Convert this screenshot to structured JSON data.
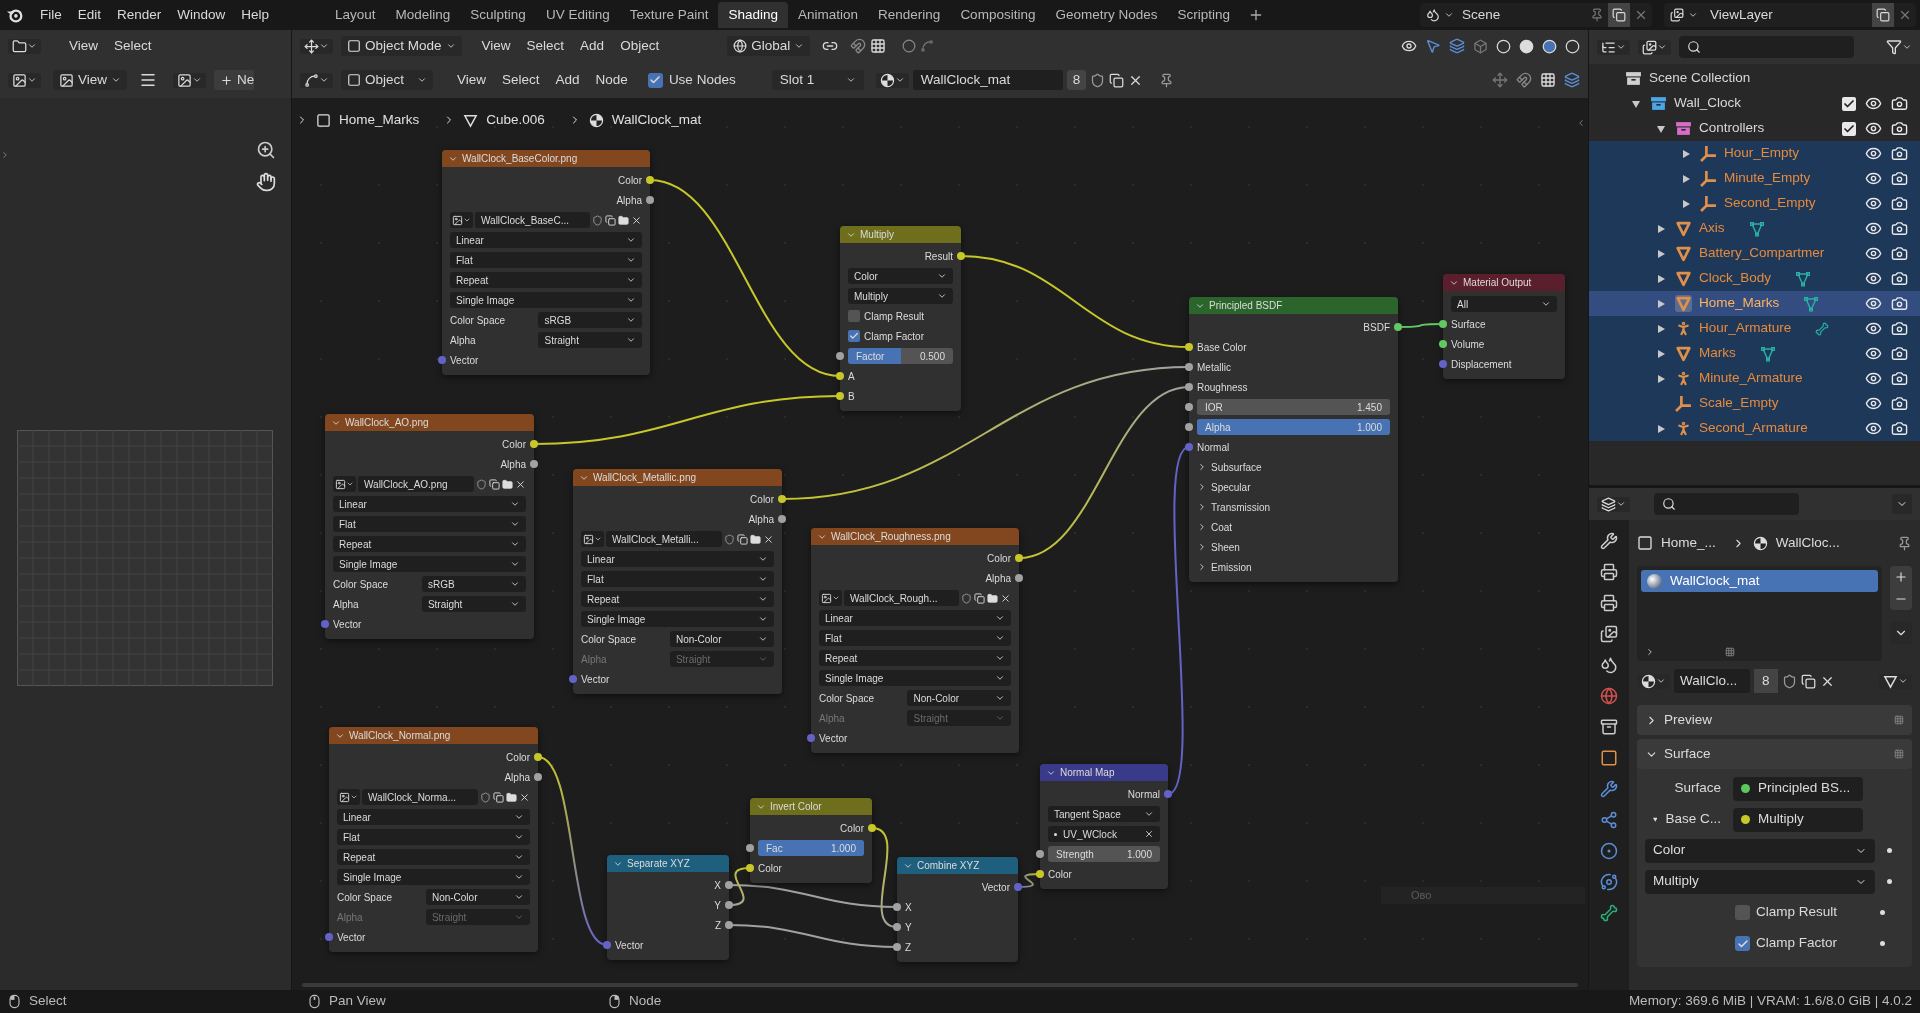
{
  "top_bar": {
    "menus": [
      "File",
      "Edit",
      "Render",
      "Window",
      "Help"
    ],
    "workspaces": [
      {
        "label": "Layout",
        "selected": false
      },
      {
        "label": "Modeling",
        "selected": false
      },
      {
        "label": "Sculpting",
        "selected": false
      },
      {
        "label": "UV Editing",
        "selected": false
      },
      {
        "label": "Texture Paint",
        "selected": false
      },
      {
        "label": "Shading",
        "selected": true
      },
      {
        "label": "Animation",
        "selected": false
      },
      {
        "label": "Rendering",
        "selected": false
      },
      {
        "label": "Compositing",
        "selected": false
      },
      {
        "label": "Geometry Nodes",
        "selected": false
      },
      {
        "label": "Scripting",
        "selected": false
      }
    ],
    "scene": "Scene",
    "view_layer": "ViewLayer"
  },
  "image_editor": {
    "menus": [
      "View",
      "Select"
    ],
    "view_menu": "View",
    "new_button": "Ne"
  },
  "viewport_header": {
    "mode": "Object Mode",
    "menus": [
      "View",
      "Select",
      "Add",
      "Object"
    ],
    "orientation": "Global"
  },
  "node_header": {
    "object_type": "Object",
    "menus": [
      "View",
      "Select",
      "Add",
      "Node"
    ],
    "use_nodes": {
      "label": "Use Nodes",
      "checked": true
    },
    "slot": "Slot 1",
    "material": "WallClock_mat",
    "users": "8"
  },
  "breadcrumbs": [
    {
      "label": "Home_Marks",
      "kind": "object"
    },
    {
      "label": "Cube.006",
      "kind": "mesh"
    },
    {
      "label": "WallClock_mat",
      "kind": "material"
    }
  ],
  "nodes": [
    {
      "title": "WallClock_BaseColor.png",
      "kind": "texture",
      "rows": [
        {
          "kind": "output",
          "label": "Color",
          "color": "#c7c729"
        },
        {
          "kind": "output",
          "label": "Alpha",
          "color": "#a1a1a1"
        },
        {
          "kind": "image",
          "value": "WallClock_BaseC..."
        },
        {
          "kind": "select",
          "value": "Linear"
        },
        {
          "kind": "select",
          "value": "Flat"
        },
        {
          "kind": "select",
          "value": "Repeat"
        },
        {
          "kind": "select",
          "value": "Single Image"
        },
        {
          "kind": "prop",
          "label": "Color Space",
          "value": "sRGB",
          "disabled": false
        },
        {
          "kind": "prop",
          "label": "Alpha",
          "value": "Straight",
          "disabled": false
        },
        {
          "kind": "input",
          "label": "Vector",
          "color": "#6363c7"
        }
      ]
    },
    {
      "title": "Multiply",
      "kind": "color",
      "rows": [
        {
          "kind": "output",
          "label": "Result",
          "color": "#c7c729"
        },
        {
          "kind": "select",
          "value": "Color"
        },
        {
          "kind": "select",
          "value": "Multiply"
        },
        {
          "kind": "checkbox",
          "label": "Clamp Result",
          "checked": false
        },
        {
          "kind": "checkbox",
          "label": "Clamp Factor",
          "checked": true
        },
        {
          "kind": "slider",
          "label": "Factor",
          "value": "0.500",
          "level": 0.5,
          "color": "#a1a1a1"
        },
        {
          "kind": "input",
          "label": "A",
          "color": "#c7c729"
        },
        {
          "kind": "input",
          "label": "B",
          "color": "#c7c729"
        }
      ]
    },
    {
      "title": "WallClock_AO.png",
      "kind": "texture",
      "rows": [
        {
          "kind": "output",
          "label": "Color",
          "color": "#c7c729"
        },
        {
          "kind": "output",
          "label": "Alpha",
          "color": "#a1a1a1"
        },
        {
          "kind": "image",
          "value": "WallClock_AO.png"
        },
        {
          "kind": "select",
          "value": "Linear"
        },
        {
          "kind": "select",
          "value": "Flat"
        },
        {
          "kind": "select",
          "value": "Repeat"
        },
        {
          "kind": "select",
          "value": "Single Image"
        },
        {
          "kind": "prop",
          "label": "Color Space",
          "value": "sRGB",
          "disabled": false
        },
        {
          "kind": "prop",
          "label": "Alpha",
          "value": "Straight",
          "disabled": false
        },
        {
          "kind": "input",
          "label": "Vector",
          "color": "#6363c7"
        }
      ]
    },
    {
      "title": "WallClock_Metallic.png",
      "kind": "texture",
      "rows": [
        {
          "kind": "output",
          "label": "Color",
          "color": "#c7c729"
        },
        {
          "kind": "output",
          "label": "Alpha",
          "color": "#a1a1a1"
        },
        {
          "kind": "image",
          "value": "WallClock_Metalli..."
        },
        {
          "kind": "select",
          "value": "Linear"
        },
        {
          "kind": "select",
          "value": "Flat"
        },
        {
          "kind": "select",
          "value": "Repeat"
        },
        {
          "kind": "select",
          "value": "Single Image"
        },
        {
          "kind": "prop",
          "label": "Color Space",
          "value": "Non-Color",
          "disabled": false
        },
        {
          "kind": "prop",
          "label": "Alpha",
          "value": "Straight",
          "disabled": true
        },
        {
          "kind": "input",
          "label": "Vector",
          "color": "#6363c7"
        }
      ]
    },
    {
      "title": "WallClock_Roughness.png",
      "kind": "texture",
      "rows": [
        {
          "kind": "output",
          "label": "Color",
          "color": "#c7c729"
        },
        {
          "kind": "output",
          "label": "Alpha",
          "color": "#a1a1a1"
        },
        {
          "kind": "image",
          "value": "WallClock_Rough..."
        },
        {
          "kind": "select",
          "value": "Linear"
        },
        {
          "kind": "select",
          "value": "Flat"
        },
        {
          "kind": "select",
          "value": "Repeat"
        },
        {
          "kind": "select",
          "value": "Single Image"
        },
        {
          "kind": "prop",
          "label": "Color Space",
          "value": "Non-Color",
          "disabled": false
        },
        {
          "kind": "prop",
          "label": "Alpha",
          "value": "Straight",
          "disabled": true
        },
        {
          "kind": "input",
          "label": "Vector",
          "color": "#6363c7"
        }
      ]
    },
    {
      "title": "Principled BSDF",
      "kind": "shader",
      "rows": [
        {
          "kind": "output",
          "label": "BSDF",
          "color": "#63c763"
        },
        {
          "kind": "input",
          "label": "Base Color",
          "color": "#c7c729"
        },
        {
          "kind": "input",
          "label": "Metallic",
          "color": "#a1a1a1"
        },
        {
          "kind": "input",
          "label": "Roughness",
          "color": "#a1a1a1"
        },
        {
          "kind": "field",
          "label": "IOR",
          "value": "1.450",
          "color": "#a1a1a1"
        },
        {
          "kind": "slider",
          "label": "Alpha",
          "value": "1.000",
          "level": 1,
          "color": "#a1a1a1"
        },
        {
          "kind": "input",
          "label": "Normal",
          "color": "#6363c7"
        },
        {
          "kind": "panel",
          "label": "Subsurface"
        },
        {
          "kind": "panel",
          "label": "Specular"
        },
        {
          "kind": "panel",
          "label": "Transmission"
        },
        {
          "kind": "panel",
          "label": "Coat"
        },
        {
          "kind": "panel",
          "label": "Sheen"
        },
        {
          "kind": "panel",
          "label": "Emission"
        }
      ]
    },
    {
      "title": "Material Output",
      "kind": "output",
      "rows": [
        {
          "kind": "select",
          "value": "All"
        },
        {
          "kind": "input",
          "label": "Surface",
          "color": "#63c763"
        },
        {
          "kind": "input",
          "label": "Volume",
          "color": "#63c763"
        },
        {
          "kind": "input",
          "label": "Displacement",
          "color": "#6363c7"
        }
      ]
    },
    {
      "title": "WallClock_Normal.png",
      "kind": "texture",
      "rows": [
        {
          "kind": "output",
          "label": "Color",
          "color": "#c7c729"
        },
        {
          "kind": "output",
          "label": "Alpha",
          "color": "#a1a1a1"
        },
        {
          "kind": "image",
          "value": "WallClock_Norma..."
        },
        {
          "kind": "select",
          "value": "Linear"
        },
        {
          "kind": "select",
          "value": "Flat"
        },
        {
          "kind": "select",
          "value": "Repeat"
        },
        {
          "kind": "select",
          "value": "Single Image"
        },
        {
          "kind": "prop",
          "label": "Color Space",
          "value": "Non-Color",
          "disabled": false
        },
        {
          "kind": "prop",
          "label": "Alpha",
          "value": "Straight",
          "disabled": true
        },
        {
          "kind": "input",
          "label": "Vector",
          "color": "#6363c7"
        }
      ]
    },
    {
      "title": "Separate XYZ",
      "kind": "vector",
      "rows": [
        {
          "kind": "output",
          "label": "X",
          "color": "#a1a1a1"
        },
        {
          "kind": "output",
          "label": "Y",
          "color": "#a1a1a1"
        },
        {
          "kind": "output",
          "label": "Z",
          "color": "#a1a1a1"
        },
        {
          "kind": "input",
          "label": "Vector",
          "color": "#6363c7"
        }
      ]
    },
    {
      "title": "Invert Color",
      "kind": "color",
      "rows": [
        {
          "kind": "output",
          "label": "Color",
          "color": "#c7c729"
        },
        {
          "kind": "slider",
          "label": "Fac",
          "value": "1.000",
          "level": 1,
          "color": "#a1a1a1"
        },
        {
          "kind": "input",
          "label": "Color",
          "color": "#c7c729"
        }
      ]
    },
    {
      "title": "Combine XYZ",
      "kind": "vector",
      "rows": [
        {
          "kind": "output",
          "label": "Vector",
          "color": "#6363c7"
        },
        {
          "kind": "input",
          "label": "X",
          "color": "#a1a1a1"
        },
        {
          "kind": "input",
          "label": "Y",
          "color": "#a1a1a1"
        },
        {
          "kind": "input",
          "label": "Z",
          "color": "#a1a1a1"
        }
      ]
    },
    {
      "title": "Normal Map",
      "kind": "normal",
      "rows": [
        {
          "kind": "output",
          "label": "Normal",
          "color": "#6363c7"
        },
        {
          "kind": "select",
          "value": "Tangent Space"
        },
        {
          "kind": "uv",
          "value": "UV_WClock"
        },
        {
          "kind": "field",
          "label": "Strength",
          "value": "1.000",
          "color": "#a1a1a1"
        },
        {
          "kind": "input",
          "label": "Color",
          "color": "#c7c729"
        }
      ]
    }
  ],
  "overlay_text": "Ово",
  "outliner": {
    "items": [
      {
        "name": "Scene Collection",
        "kind": "collection",
        "color": "#d0d0d0",
        "selected": false,
        "active": false,
        "children": [
          {
            "name": "Wall_Clock",
            "kind": "collection",
            "color": "#4ca6e6",
            "expanded": true,
            "checked": true,
            "selected": false,
            "active": false,
            "children": [
              {
                "name": "Controllers",
                "kind": "collection",
                "color": "#d56ec6",
                "expanded": true,
                "checked": true,
                "selected": false,
                "active": false,
                "children": [
                  {
                    "name": "Hour_Empty",
                    "kind": "empty",
                    "expanded": false,
                    "selected": true,
                    "active": false
                  },
                  {
                    "name": "Minute_Empty",
                    "kind": "empty",
                    "expanded": false,
                    "selected": true,
                    "active": false
                  },
                  {
                    "name": "Second_Empty",
                    "kind": "empty",
                    "expanded": false,
                    "selected": true,
                    "active": false
                  }
                ]
              },
              {
                "name": "Axis",
                "kind": "mesh",
                "data": {
                  "kind": "mesh"
                },
                "expanded": false,
                "selected": true,
                "active": false
              },
              {
                "name": "Battery_Compartmer",
                "kind": "mesh",
                "expanded": false,
                "selected": true,
                "active": false
              },
              {
                "name": "Clock_Body",
                "kind": "mesh",
                "data": {
                  "kind": "mesh"
                },
                "expanded": false,
                "selected": true,
                "active": false
              },
              {
                "name": "Home_Marks",
                "kind": "mesh",
                "data": {
                  "kind": "mesh"
                },
                "expanded": false,
                "selected": true,
                "active": true
              },
              {
                "name": "Hour_Armature",
                "kind": "armature",
                "data": {
                  "kind": "armature"
                },
                "expanded": false,
                "selected": true,
                "active": false
              },
              {
                "name": "Marks",
                "kind": "mesh",
                "data": {
                  "kind": "mesh"
                },
                "expanded": false,
                "selected": true,
                "active": false
              },
              {
                "name": "Minute_Armature",
                "kind": "armature",
                "expanded": false,
                "selected": true,
                "active": false
              },
              {
                "name": "Scale_Empty",
                "kind": "empty",
                "selected": true,
                "active": false
              },
              {
                "name": "Second_Armature",
                "kind": "armature",
                "expanded": false,
                "selected": true,
                "active": false
              }
            ]
          }
        ]
      }
    ]
  },
  "properties": {
    "breadcrumbs": [
      "Home_...",
      "WallCloc..."
    ],
    "slots": [
      {
        "name": "WallClock_mat",
        "selected": true
      }
    ],
    "material": {
      "name": "WallClo...",
      "users": "8"
    },
    "panels": [
      {
        "title": "Preview",
        "expanded": false
      },
      {
        "title": "Surface",
        "expanded": true,
        "rows": [
          {
            "kind": "link",
            "label": "Surface",
            "value": "Principled BS...",
            "color": "#5cc75c"
          },
          {
            "kind": "link",
            "label": "Base C...",
            "value": "Multiply",
            "color": "#c7c729",
            "expanded": true
          },
          {
            "kind": "select",
            "value": "Color"
          },
          {
            "kind": "select",
            "value": "Multiply"
          },
          {
            "kind": "checkbox",
            "label": "Clamp Result",
            "checked": false
          },
          {
            "kind": "checkbox",
            "label": "Clamp Factor",
            "checked": true
          }
        ]
      }
    ]
  },
  "status_bar": {
    "hints": [
      {
        "label": "Select",
        "kind": "left"
      },
      {
        "label": "Pan View",
        "kind": "middle"
      },
      {
        "label": "Node",
        "kind": "right"
      }
    ],
    "info": "Memory: 369.6 MiB | VRAM: 1.6/8.0 GiB | 4.0.2"
  }
}
